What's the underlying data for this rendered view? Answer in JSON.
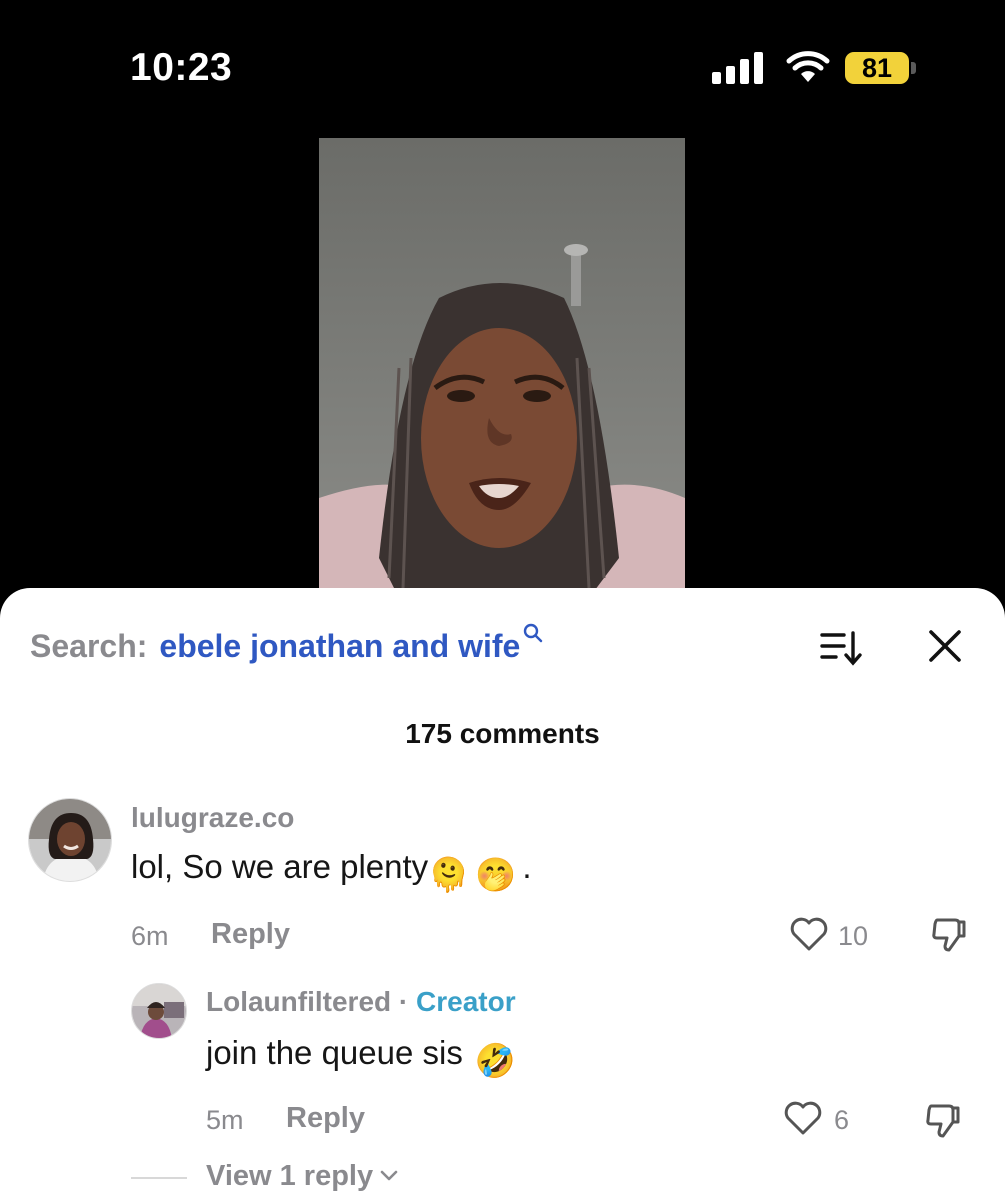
{
  "status_bar": {
    "time": "10:23",
    "battery": "81",
    "colors": {
      "battery": "#f2d23a"
    }
  },
  "icons": {
    "signal": "cellular-signal-icon",
    "wifi": "wifi-icon",
    "battery": "battery-icon",
    "search_suggestion": "search-icon",
    "sort": "sort-icon",
    "close": "close-icon",
    "like": "heart-icon",
    "dislike": "thumbs-down-icon",
    "chevron": "chevron-down-icon"
  },
  "sheet": {
    "search_prefix": "Search:",
    "search_query": "ebele jonathan and wife",
    "comment_count": "175 comments",
    "colors": {
      "query": "#2f58c2",
      "creator": "#3aa0c8",
      "muted": "#8a8a8e"
    }
  },
  "comments": [
    {
      "username": "lulugraze.co",
      "text": "lol, So we are plenty",
      "emojis": [
        "🫠",
        "🤭"
      ],
      "trailing": ".",
      "time": "6m",
      "reply_label": "Reply",
      "likes": "10"
    }
  ],
  "replies": [
    {
      "username": "Lolaunfiltered",
      "separator": "·",
      "badge": "Creator",
      "text": "join the queue sis",
      "emoji": "🤣",
      "time": "5m",
      "reply_label": "Reply",
      "likes": "6"
    }
  ],
  "view_replies": "View 1 reply"
}
